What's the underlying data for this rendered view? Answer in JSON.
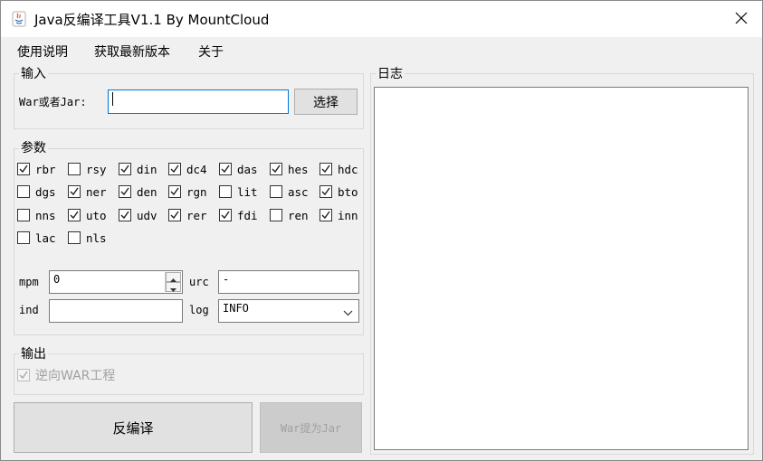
{
  "window": {
    "title": "Java反编译工具V1.1 By MountCloud"
  },
  "menu": [
    {
      "name": "menu-usage",
      "label": "使用说明"
    },
    {
      "name": "menu-latest",
      "label": "获取最新版本"
    },
    {
      "name": "menu-about",
      "label": "关于"
    }
  ],
  "input_group": {
    "label": "输入",
    "field_label": "War或者Jar:",
    "field_value": "",
    "choose_button": "选择"
  },
  "params_group": {
    "label": "参数",
    "options": [
      {
        "label": "rbr",
        "checked": true
      },
      {
        "label": "rsy",
        "checked": false
      },
      {
        "label": "din",
        "checked": true
      },
      {
        "label": "dc4",
        "checked": true
      },
      {
        "label": "das",
        "checked": true
      },
      {
        "label": "hes",
        "checked": true
      },
      {
        "label": "hdc",
        "checked": true
      },
      {
        "label": "dgs",
        "checked": false
      },
      {
        "label": "ner",
        "checked": true
      },
      {
        "label": "den",
        "checked": true
      },
      {
        "label": "rgn",
        "checked": true
      },
      {
        "label": "lit",
        "checked": false
      },
      {
        "label": "asc",
        "checked": false
      },
      {
        "label": "bto",
        "checked": true
      },
      {
        "label": "nns",
        "checked": false
      },
      {
        "label": "uto",
        "checked": true
      },
      {
        "label": "udv",
        "checked": true
      },
      {
        "label": "rer",
        "checked": true
      },
      {
        "label": "fdi",
        "checked": true
      },
      {
        "label": "ren",
        "checked": false
      },
      {
        "label": "inn",
        "checked": true
      },
      {
        "label": "lac",
        "checked": false
      },
      {
        "label": "nls",
        "checked": false
      }
    ],
    "mpm_label": "mpm",
    "mpm_value": "0",
    "urc_label": "urc",
    "urc_value": "-",
    "ind_label": "ind",
    "ind_value": "",
    "log_label": "log",
    "log_value": "INFO"
  },
  "output_group": {
    "label": "输出",
    "reverse_war_label": "逆向WAR工程",
    "reverse_war_checked": true
  },
  "actions": {
    "decompile_button": "反编译",
    "war_to_jar_button": "War提为Jar"
  },
  "log_group": {
    "label": "日志",
    "content": ""
  }
}
